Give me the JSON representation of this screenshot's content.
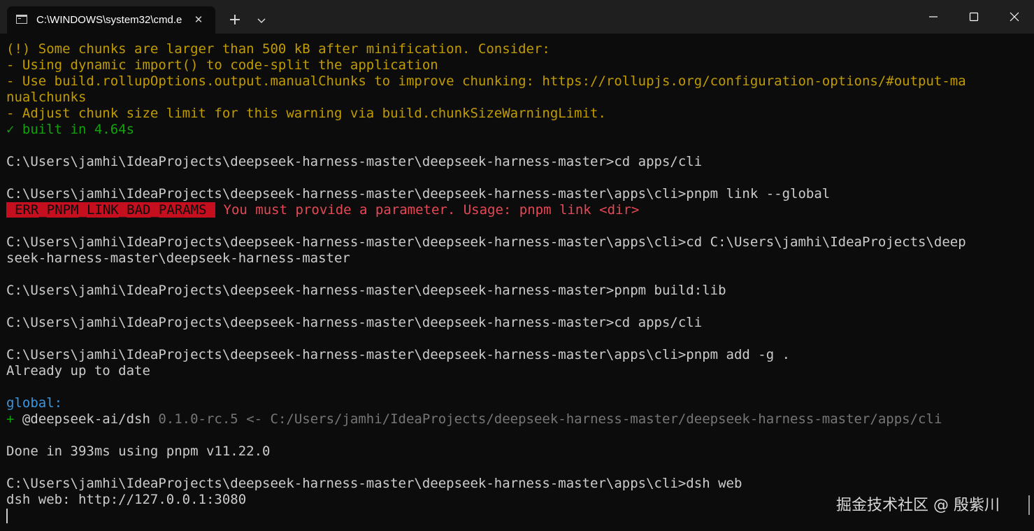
{
  "window": {
    "tab_title": "C:\\WINDOWS\\system32\\cmd.e",
    "tab_close_glyph": "✕",
    "new_tab_glyph": "+",
    "icons": {
      "terminal": "cmd-icon",
      "close_tab": "close-icon",
      "new_tab": "plus-icon",
      "dropdown": "chevron-down-icon",
      "minimize": "minimize-icon",
      "maximize": "maximize-icon",
      "close_window": "close-icon"
    }
  },
  "colors": {
    "background": "#0c0c0c",
    "titlebar": "#1f1f1f",
    "text": "#cccccc",
    "yellow": "#c19c00",
    "green": "#13a10e",
    "cyan": "#3a96dd",
    "red": "#e74856",
    "error_badge": "#c50f1f",
    "grey": "#767676"
  },
  "terminal": {
    "lines": [
      {
        "segments": [
          {
            "text": "(!) Some chunks are larger than 500 kB after minification. Consider:",
            "style": "yellow"
          }
        ]
      },
      {
        "segments": [
          {
            "text": "- Using dynamic import() to code-split the application",
            "style": "yellow"
          }
        ]
      },
      {
        "segments": [
          {
            "text": "- Use build.rollupOptions.output.manualChunks to improve chunking: https://rollupjs.org/configuration-options/#output-ma",
            "style": "yellow"
          }
        ]
      },
      {
        "segments": [
          {
            "text": "nualchunks",
            "style": "yellow"
          }
        ]
      },
      {
        "segments": [
          {
            "text": "- Adjust chunk size limit for this warning via build.chunkSizeWarningLimit.",
            "style": "yellow"
          }
        ]
      },
      {
        "segments": [
          {
            "text": "✓ built in 4.64s",
            "style": "green"
          }
        ]
      },
      {
        "segments": []
      },
      {
        "segments": [
          {
            "text": "C:\\Users\\jamhi\\IdeaProjects\\deepseek-harness-master\\deepseek-harness-master>cd apps/cli",
            "style": "plain"
          }
        ]
      },
      {
        "segments": []
      },
      {
        "segments": [
          {
            "text": "C:\\Users\\jamhi\\IdeaProjects\\deepseek-harness-master\\deepseek-harness-master\\apps\\cli>pnpm link --global",
            "style": "plain"
          }
        ]
      },
      {
        "segments": [
          {
            "text": "ERR_PNPM_LINK_BAD_PARAMS",
            "style": "badge"
          },
          {
            "text": "You must provide a parameter. Usage: pnpm link <dir>",
            "style": "red"
          }
        ]
      },
      {
        "segments": []
      },
      {
        "segments": [
          {
            "text": "C:\\Users\\jamhi\\IdeaProjects\\deepseek-harness-master\\deepseek-harness-master\\apps\\cli>cd C:\\Users\\jamhi\\IdeaProjects\\deep",
            "style": "plain"
          }
        ]
      },
      {
        "segments": [
          {
            "text": "seek-harness-master\\deepseek-harness-master",
            "style": "plain"
          }
        ]
      },
      {
        "segments": []
      },
      {
        "segments": [
          {
            "text": "C:\\Users\\jamhi\\IdeaProjects\\deepseek-harness-master\\deepseek-harness-master>pnpm build:lib",
            "style": "plain"
          }
        ]
      },
      {
        "segments": []
      },
      {
        "segments": [
          {
            "text": "C:\\Users\\jamhi\\IdeaProjects\\deepseek-harness-master\\deepseek-harness-master>cd apps/cli",
            "style": "plain"
          }
        ]
      },
      {
        "segments": []
      },
      {
        "segments": [
          {
            "text": "C:\\Users\\jamhi\\IdeaProjects\\deepseek-harness-master\\deepseek-harness-master\\apps\\cli>pnpm add -g .",
            "style": "plain"
          }
        ]
      },
      {
        "segments": [
          {
            "text": "Already up to date",
            "style": "plain"
          }
        ]
      },
      {
        "segments": []
      },
      {
        "segments": [
          {
            "text": "global:",
            "style": "cyan"
          }
        ]
      },
      {
        "segments": [
          {
            "text": "+",
            "style": "green"
          },
          {
            "text": " @deepseek-ai/dsh ",
            "style": "plain"
          },
          {
            "text": "0.1.0-rc.5 <- C:/Users/jamhi/IdeaProjects/deepseek-harness-master/deepseek-harness-master/apps/cli",
            "style": "grey"
          }
        ]
      },
      {
        "segments": []
      },
      {
        "segments": [
          {
            "text": "Done in 393ms using pnpm v11.22.0",
            "style": "plain"
          }
        ]
      },
      {
        "segments": []
      },
      {
        "segments": [
          {
            "text": "C:\\Users\\jamhi\\IdeaProjects\\deepseek-harness-master\\deepseek-harness-master\\apps\\cli>dsh web",
            "style": "plain"
          }
        ]
      },
      {
        "segments": [
          {
            "text": "dsh web: http://127.0.0.1:3080",
            "style": "plain"
          }
        ]
      },
      {
        "segments": [],
        "cursor": true
      }
    ]
  },
  "watermark": "掘金技术社区 @ 殷紫川"
}
